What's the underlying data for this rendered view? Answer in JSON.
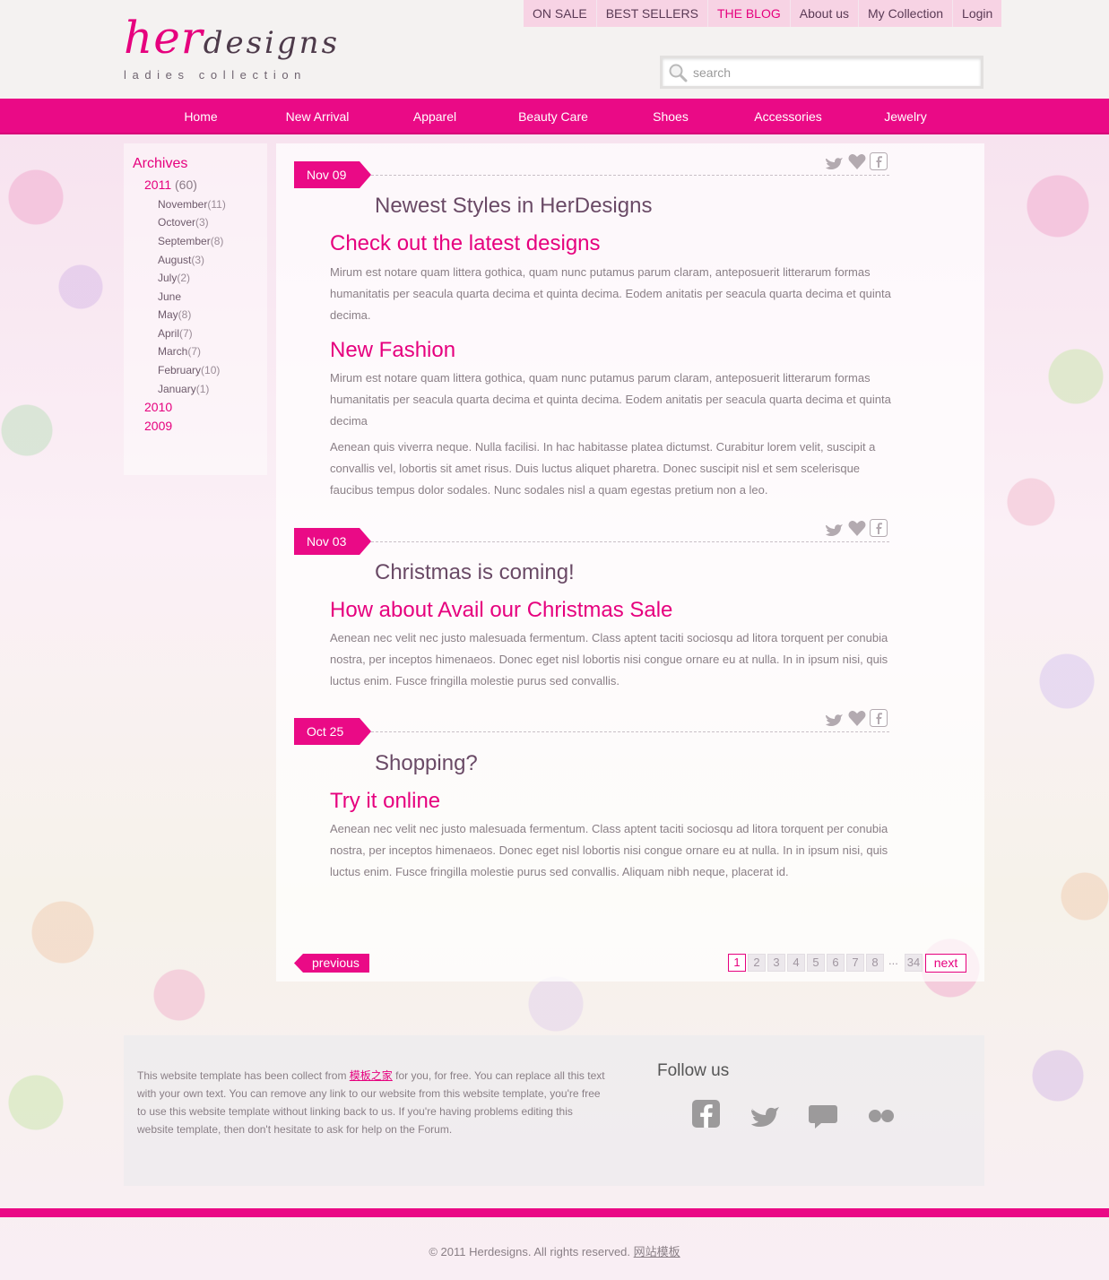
{
  "brand": {
    "logo_her": "her",
    "logo_designs": "designs",
    "tagline": "ladies collection"
  },
  "top_nav": [
    {
      "label": "ON SALE",
      "active": false
    },
    {
      "label": "BEST SELLERS",
      "active": false
    },
    {
      "label": "THE BLOG",
      "active": true
    },
    {
      "label": "About us",
      "active": false
    },
    {
      "label": "My Collection",
      "active": false
    },
    {
      "label": "Login",
      "active": false
    }
  ],
  "search": {
    "placeholder": "search"
  },
  "main_nav": [
    "Home",
    "New Arrival",
    "Apparel",
    "Beauty Care",
    "Shoes",
    "Accessories",
    "Jewelry"
  ],
  "archives": {
    "title": "Archives",
    "years": [
      {
        "label": "2011",
        "count": "(60)"
      },
      {
        "label": "2010",
        "count": ""
      },
      {
        "label": "2009",
        "count": ""
      }
    ],
    "months": [
      {
        "label": "November",
        "count": "(11)"
      },
      {
        "label": "Octover",
        "count": "(3)"
      },
      {
        "label": "September",
        "count": "(8)"
      },
      {
        "label": "August",
        "count": "(3)"
      },
      {
        "label": "July",
        "count": "(2)"
      },
      {
        "label": "June",
        "count": ""
      },
      {
        "label": "May",
        "count": "(8)"
      },
      {
        "label": "April",
        "count": "(7)"
      },
      {
        "label": "March",
        "count": "(7)"
      },
      {
        "label": "February",
        "count": "(10)"
      },
      {
        "label": "January",
        "count": "(1)"
      }
    ]
  },
  "posts": [
    {
      "date": "Nov 09",
      "title": "Newest Styles in HerDesigns",
      "sections": [
        {
          "heading": "Check out the latest designs",
          "paragraphs": [
            "Mirum est notare quam littera gothica, quam nunc putamus parum claram, anteposuerit litterarum formas humanitatis per seacula quarta decima et quinta decima. Eodem anitatis per seacula quarta decima et quinta decima."
          ]
        },
        {
          "heading": "New Fashion",
          "paragraphs": [
            "Mirum est notare quam littera gothica, quam nunc putamus parum claram, anteposuerit litterarum formas humanitatis per seacula quarta decima et quinta decima. Eodem anitatis per seacula quarta decima et quinta decima",
            "Aenean quis viverra neque. Nulla facilisi. In hac habitasse platea dictumst. Curabitur lorem velit, suscipit a convallis vel, lobortis sit amet risus. Duis luctus aliquet pharetra. Donec suscipit nisl et sem scelerisque faucibus tempus dolor sodales. Nunc sodales nisl a quam egestas pretium non a leo."
          ]
        }
      ]
    },
    {
      "date": "Nov 03",
      "title": "Christmas is coming!",
      "sections": [
        {
          "heading": "How about Avail our Christmas Sale",
          "paragraphs": [
            "Aenean nec velit nec justo malesuada fermentum. Class aptent taciti sociosqu ad litora torquent per conubia nostra, per inceptos himenaeos. Donec eget nisl lobortis nisi congue ornare eu at nulla. In in ipsum nisi, quis luctus enim. Fusce fringilla molestie purus sed convallis."
          ]
        }
      ]
    },
    {
      "date": "Oct 25",
      "title": "Shopping?",
      "sections": [
        {
          "heading": "Try it online",
          "paragraphs": [
            "Aenean nec velit nec justo malesuada fermentum. Class aptent taciti sociosqu ad litora torquent per conubia nostra, per inceptos himenaeos. Donec eget nisl lobortis nisi congue ornare eu at nulla. In in ipsum nisi, quis luctus enim. Fusce fringilla molestie purus sed convallis. Aliquam nibh neque, placerat id."
          ]
        }
      ]
    }
  ],
  "pagination": {
    "previous": "previous",
    "pages": [
      "1",
      "2",
      "3",
      "4",
      "5",
      "6",
      "7",
      "8"
    ],
    "current": "1",
    "ellipsis": "...",
    "last": "34",
    "next": "next"
  },
  "footer": {
    "text_before": "This website template has been collect from ",
    "link_text": "模板之家",
    "text_after": " for you, for free. You can replace all this text with your own text. You can remove any link to our website from this website template, you're free to use this website template without linking back to us. If you're having problems editing this website template, then don't hesitate to ask for help on the Forum.",
    "follow_title": "Follow us",
    "social_icons": [
      "facebook-icon",
      "twitter-icon",
      "chat-icon",
      "flickr-icon"
    ]
  },
  "copyright": {
    "text": "© 2011 Herdesigns. All rights reserved.",
    "link": "网站模板"
  },
  "colors": {
    "accent": "#e6007e",
    "nav_bar": "#ea0a86",
    "top_nav_bg": "#f7d3e4",
    "title": "#6a4a66",
    "body_text": "#8a7f86"
  }
}
